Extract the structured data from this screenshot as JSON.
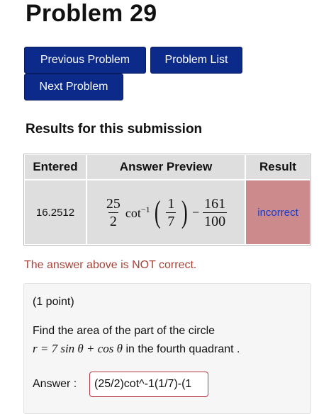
{
  "page": {
    "title": "Problem 29"
  },
  "nav": {
    "previous_label": "Previous Problem",
    "list_label": "Problem List",
    "next_label": "Next Problem"
  },
  "results": {
    "heading": "Results for this submission",
    "columns": [
      "Entered",
      "Answer Preview",
      "Result"
    ],
    "row": {
      "entered": "16.2512",
      "preview": {
        "frac1_num": "25",
        "frac1_den": "2",
        "func": "cot",
        "exp": "−1",
        "frac2_num": "1",
        "frac2_den": "7",
        "minus": "−",
        "frac3_num": "161",
        "frac3_den": "100"
      },
      "result": "incorrect"
    },
    "status_message": "The answer above is NOT correct."
  },
  "problem": {
    "points": "(1 point)",
    "prompt_line1": "Find the area of the part of the circle",
    "prompt_eq": "r = 7 sin θ + cos θ",
    "prompt_tail": " in the fourth quadrant .",
    "answer_label": "Answer :",
    "answer_value": "(25/2)cot^-1(1/7)-(1"
  },
  "colors": {
    "button_bg": "#0b2a8a",
    "incorrect_bg": "#cc8a8c",
    "incorrect_text": "#1a3cc4",
    "error_text": "#a8433a"
  }
}
